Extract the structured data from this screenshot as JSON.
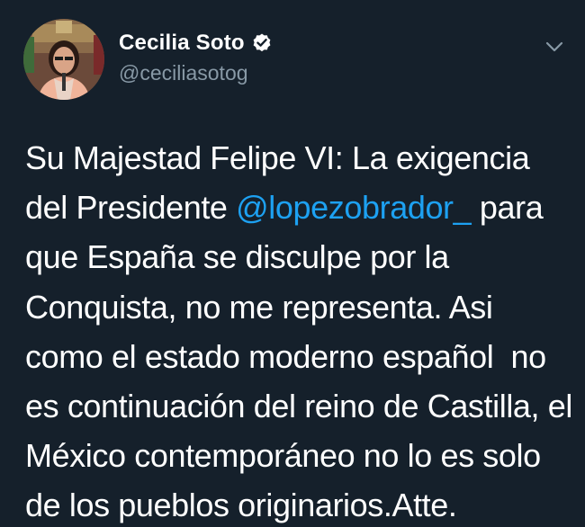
{
  "tweet": {
    "author": {
      "display_name": "Cecilia Soto",
      "handle": "@ceciliasotog",
      "verified": true
    },
    "icons": {
      "verified": "verified-badge-icon",
      "menu": "chevron-down-icon"
    },
    "colors": {
      "background": "#15202b",
      "text": "#ffffff",
      "secondary": "#8899a6",
      "link": "#1da1f2"
    },
    "lines": {
      "l1": "Su Majestad Felipe VI: La exigencia",
      "l2_pre": "del Presidente ",
      "l2_mention": "@lopezobrador_",
      "l2_post": " para",
      "l3": "que España se disculpe por la",
      "l4": "Conquista, no me representa. Asi",
      "l5": "como el estado moderno español  no",
      "l6": "es continuación del reino de Castilla, el",
      "l7": "México contemporáneo no lo es solo",
      "l8": "de los pueblos originarios.Atte."
    }
  }
}
